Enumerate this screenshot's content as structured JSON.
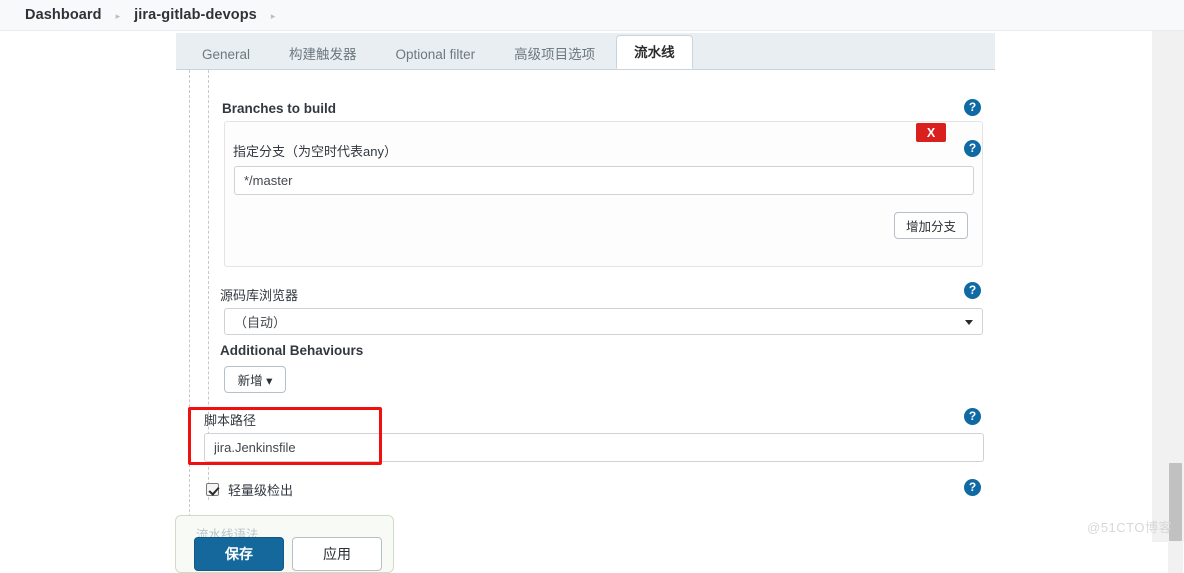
{
  "breadcrumb": {
    "items": [
      "Dashboard",
      "jira-gitlab-devops"
    ],
    "separator": "▸",
    "trailing_separator": "▸"
  },
  "tabs": [
    {
      "label": "General",
      "active": false
    },
    {
      "label": "构建触发器",
      "active": false
    },
    {
      "label": "Optional filter",
      "active": false
    },
    {
      "label": "高级项目选项",
      "active": false
    },
    {
      "label": "流水线",
      "active": true
    }
  ],
  "form": {
    "branches_section_label": "Branches to build",
    "branch_spec_label": "指定分支（为空时代表any）",
    "branch_spec_value": "*/master",
    "branch_spec_placeholder": "",
    "remove_branch_label": "X",
    "add_branch_label": "增加分支",
    "repo_browser_label": "源码库浏览器",
    "repo_browser_value": "（自动）",
    "additional_behaviours_label": "Additional Behaviours",
    "add_behaviour_label": "新增",
    "add_behaviour_caret": "▾",
    "script_path_label": "脚本路径",
    "script_path_value": "jira.Jenkinsfile",
    "script_path_placeholder": "",
    "lightweight_checkout_label": "轻量级检出",
    "lightweight_checkout_checked": true,
    "help_glyph": "?"
  },
  "submit_bar": {
    "pipeline_syntax_label": "流水线语法",
    "save_label": "保存",
    "apply_label": "应用"
  },
  "watermark": "@51CTO博客",
  "colors": {
    "accent_blue": "#14689c",
    "help_blue": "#0f6aa3",
    "danger_red": "#d9201f",
    "highlight_red": "#f01010",
    "tabbar_bg": "#e9eef2"
  }
}
